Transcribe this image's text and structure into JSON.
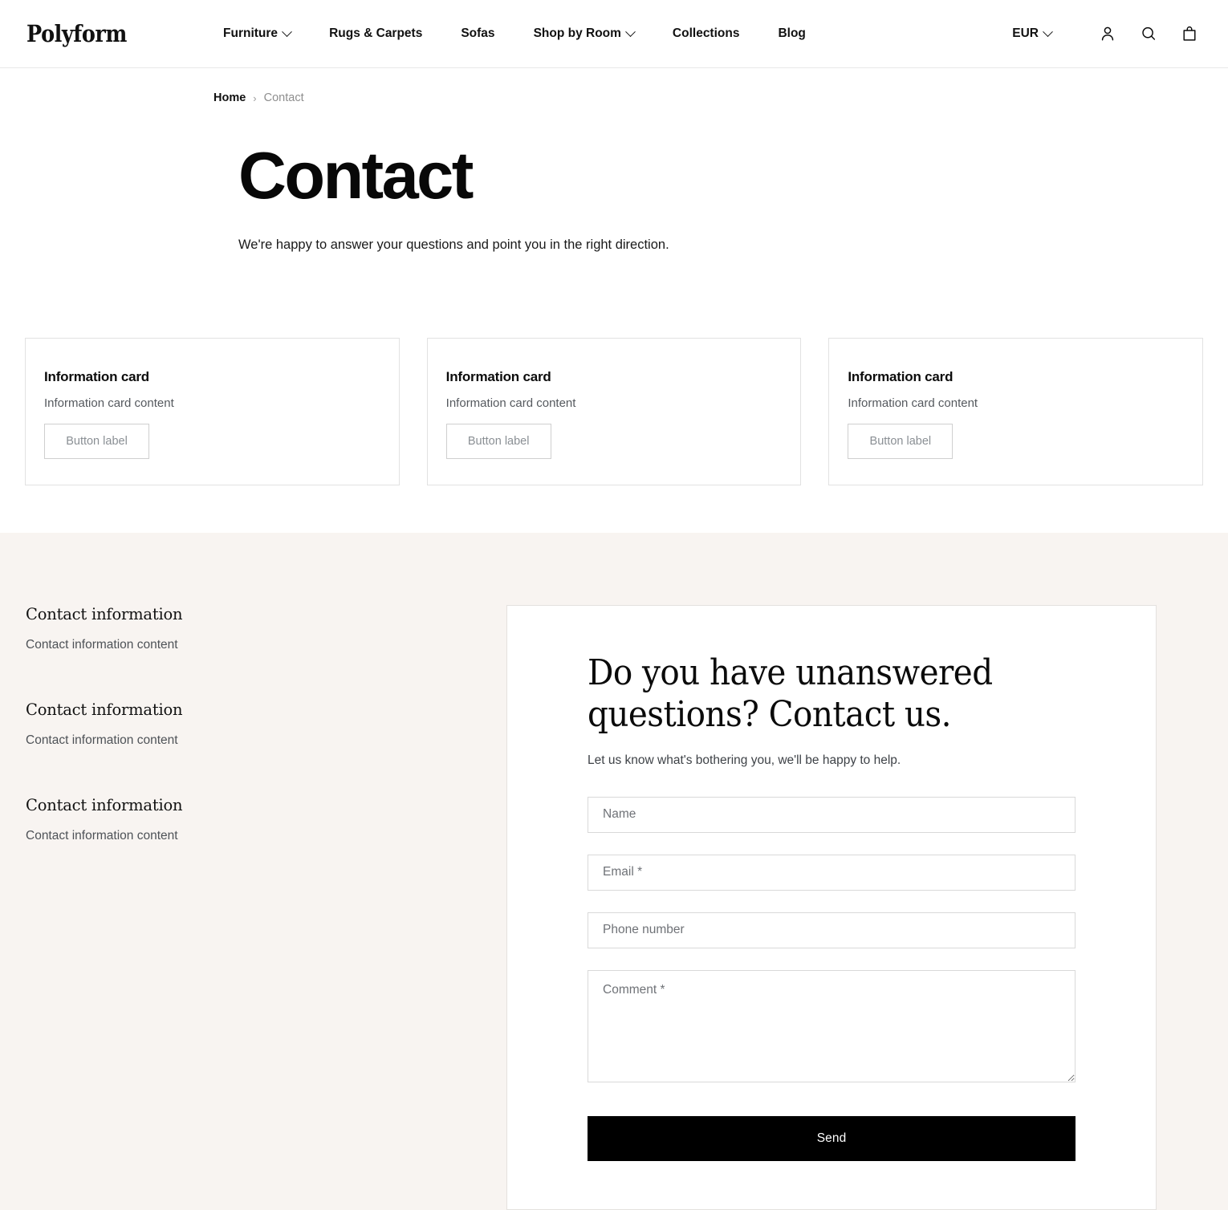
{
  "header": {
    "brand": "Polyform",
    "nav": [
      {
        "label": "Furniture",
        "has_dropdown": true,
        "icon": "chevron-down-icon"
      },
      {
        "label": "Rugs & Carpets",
        "has_dropdown": false
      },
      {
        "label": "Sofas",
        "has_dropdown": false
      },
      {
        "label": "Shop by Room",
        "has_dropdown": true,
        "icon": "chevron-down-icon"
      },
      {
        "label": "Collections",
        "has_dropdown": false
      },
      {
        "label": "Blog",
        "has_dropdown": false
      }
    ],
    "currency": {
      "value": "EUR",
      "icon": "chevron-down-icon"
    },
    "icons": [
      {
        "name": "account-icon",
        "label": "Account"
      },
      {
        "name": "search-icon",
        "label": "Search"
      },
      {
        "name": "cart-icon",
        "label": "Cart"
      }
    ]
  },
  "breadcrumb": {
    "home": "Home",
    "separator": "›",
    "current": "Contact"
  },
  "page": {
    "title": "Contact",
    "subtitle": "We're happy to answer your questions and point you in the right direction."
  },
  "cards": [
    {
      "title": "Information card",
      "content": "Information card content",
      "button_label": "Button label"
    },
    {
      "title": "Information card",
      "content": "Information card content",
      "button_label": "Button label"
    },
    {
      "title": "Information card",
      "content": "Information card content",
      "button_label": "Button label"
    }
  ],
  "contact_info": [
    {
      "title": "Contact information",
      "content": "Contact information content"
    },
    {
      "title": "Contact information",
      "content": "Contact information content"
    },
    {
      "title": "Contact information",
      "content": "Contact information content"
    }
  ],
  "form": {
    "heading": "Do you have unanswered questions? Contact us.",
    "subheading": "Let us know what's bothering you, we'll be happy to help.",
    "fields": [
      {
        "name": "name",
        "placeholder": "Name",
        "value": "",
        "type": "text",
        "required": false
      },
      {
        "name": "email",
        "placeholder": "Email *",
        "value": "",
        "type": "email",
        "required": true
      },
      {
        "name": "phone",
        "placeholder": "Phone number",
        "value": "",
        "type": "tel",
        "required": false
      },
      {
        "name": "comment",
        "placeholder": "Comment *",
        "value": "",
        "type": "textarea",
        "required": true
      }
    ],
    "submit_label": "Send"
  },
  "colors": {
    "accent": "#000000",
    "section_background": "#f8f4f1",
    "page_background": "#ffffff",
    "border": "#e2e2e2",
    "muted_text": "#8a8f94"
  }
}
